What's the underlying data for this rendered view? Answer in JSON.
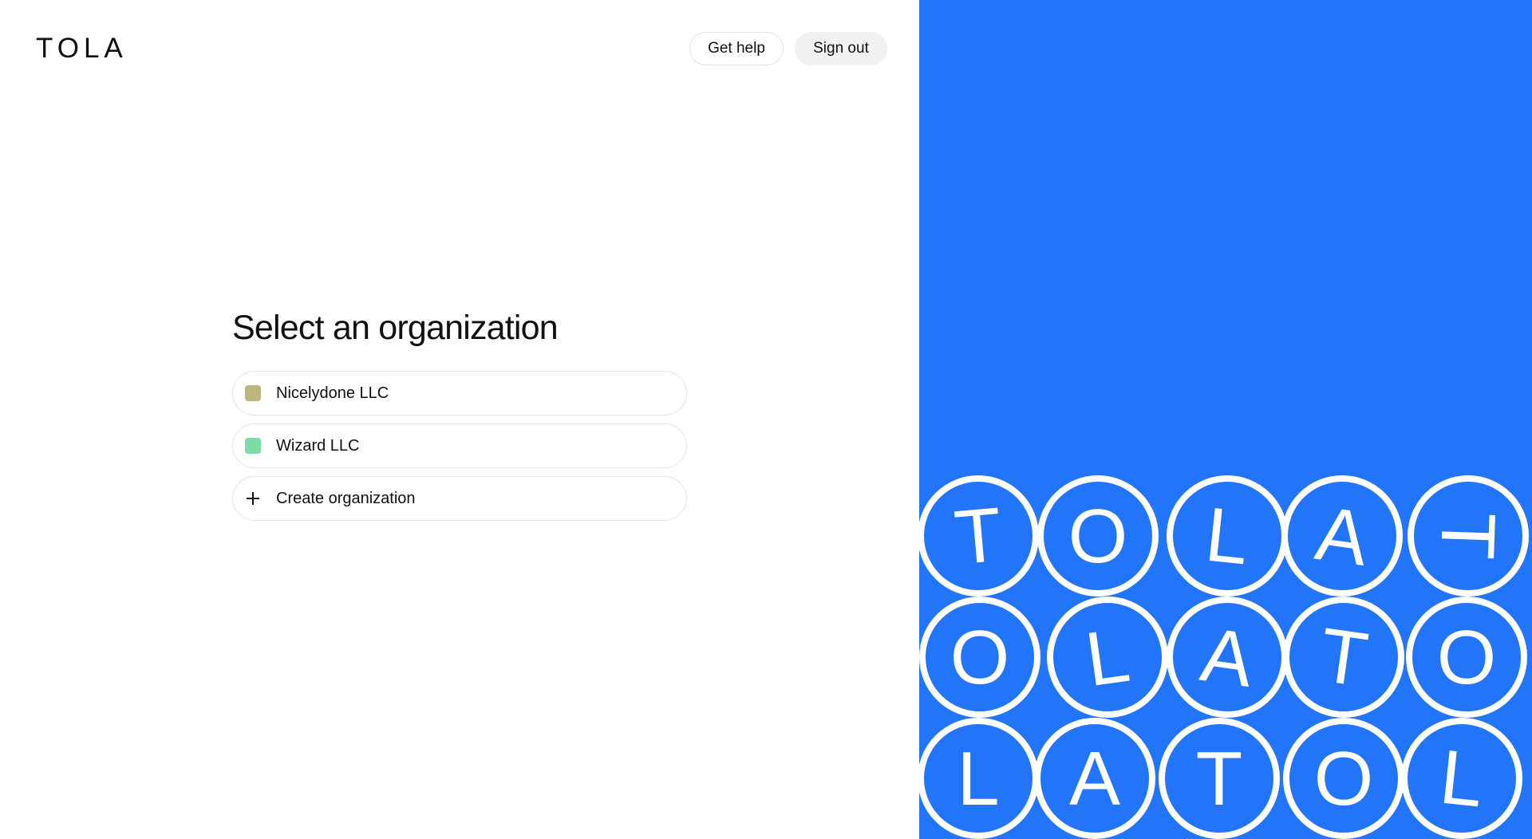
{
  "brand": {
    "logo_text": "TOLA"
  },
  "header": {
    "help_label": "Get help",
    "signout_label": "Sign out"
  },
  "main": {
    "title": "Select an organization",
    "organizations": [
      {
        "name": "Nicelydone LLC",
        "color": "#bdb67c"
      },
      {
        "name": "Wizard LLC",
        "color": "#7ddba6"
      }
    ],
    "create_label": "Create organization"
  },
  "decor": {
    "background_color": "#2274f9",
    "ring_color": "#ffffff",
    "rows": [
      [
        "T",
        "O",
        "L",
        "A",
        "T"
      ],
      [
        "O",
        "L",
        "A",
        "T",
        "O"
      ],
      [
        "L",
        "A",
        "T",
        "O",
        "L"
      ]
    ]
  }
}
